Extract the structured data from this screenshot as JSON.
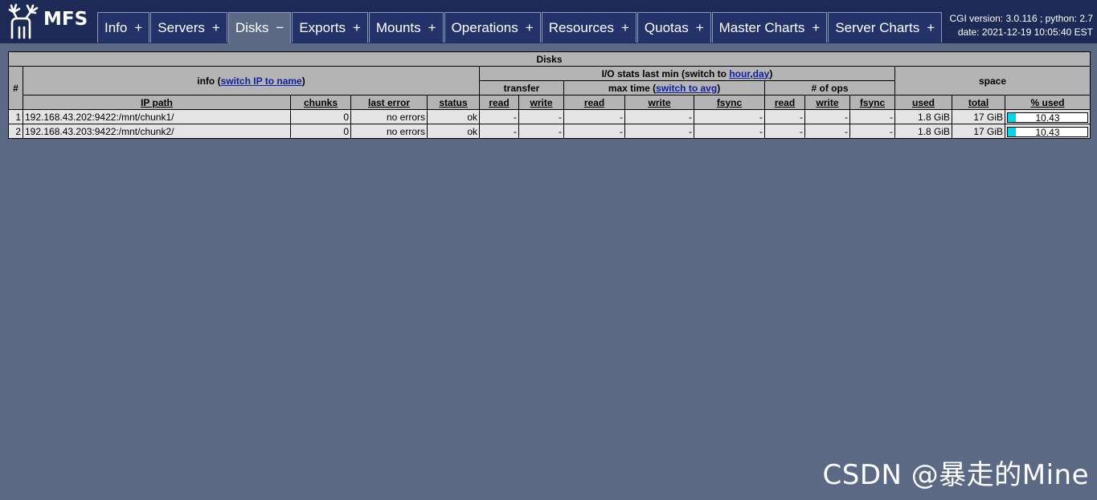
{
  "header": {
    "logo_text": "MFS",
    "tabs": [
      {
        "label": "Info",
        "toggle": "+",
        "active": false
      },
      {
        "label": "Servers",
        "toggle": "+",
        "active": false
      },
      {
        "label": "Disks",
        "toggle": "−",
        "active": true
      },
      {
        "label": "Exports",
        "toggle": "+",
        "active": false
      },
      {
        "label": "Mounts",
        "toggle": "+",
        "active": false
      },
      {
        "label": "Operations",
        "toggle": "+",
        "active": false
      },
      {
        "label": "Resources",
        "toggle": "+",
        "active": false
      },
      {
        "label": "Quotas",
        "toggle": "+",
        "active": false
      },
      {
        "label": "Master Charts",
        "toggle": "+",
        "active": false
      },
      {
        "label": "Server Charts",
        "toggle": "+",
        "active": false
      }
    ],
    "cgi_version": "CGI version: 3.0.116 ; python: 2.7",
    "date": "date: 2021-12-19 10:05:40 EST"
  },
  "table": {
    "title": "Disks",
    "hash": "#",
    "info_prefix": "info (",
    "info_link": "switch IP to name",
    "info_suffix": ")",
    "io_prefix": "I/O stats last min (switch to ",
    "io_link_hour": "hour",
    "io_link_sep": ",",
    "io_link_day": "day",
    "io_suffix": ")",
    "space": "space",
    "transfer": "transfer",
    "maxtime_prefix": "max time (",
    "maxtime_link": "switch to avg",
    "maxtime_suffix": ")",
    "ops": "# of ops",
    "columns": {
      "ip_path": "IP path",
      "chunks": "chunks",
      "last_error": "last error",
      "status": "status",
      "read": "read",
      "write": "write",
      "fsync": "fsync",
      "used": "used",
      "total": "total",
      "pct_used": "% used"
    },
    "rows": [
      {
        "num": "1",
        "ip_path": "192.168.43.202:9422:/mnt/chunk1/",
        "chunks": "0",
        "last_error": "no errors",
        "status": "ok",
        "tr_read": "-",
        "tr_write": "-",
        "mt_read": "-",
        "mt_write": "-",
        "mt_fsync": "-",
        "op_read": "-",
        "op_write": "-",
        "op_fsync": "-",
        "used": "1.8 GiB",
        "total": "17 GiB",
        "pct": "10.43",
        "pct_value": 10.43
      },
      {
        "num": "2",
        "ip_path": "192.168.43.203:9422:/mnt/chunk2/",
        "chunks": "0",
        "last_error": "no errors",
        "status": "ok",
        "tr_read": "-",
        "tr_write": "-",
        "mt_read": "-",
        "mt_write": "-",
        "mt_fsync": "-",
        "op_read": "-",
        "op_write": "-",
        "op_fsync": "-",
        "used": "1.8 GiB",
        "total": "17 GiB",
        "pct": "10.43",
        "pct_value": 10.43
      }
    ]
  },
  "watermark": "CSDN @暴走的Mine",
  "colors": {
    "header_bg": "#1d2a55",
    "page_bg": "#5b6985",
    "bar_fill": "#00d7e6",
    "link": "#1020a0"
  }
}
